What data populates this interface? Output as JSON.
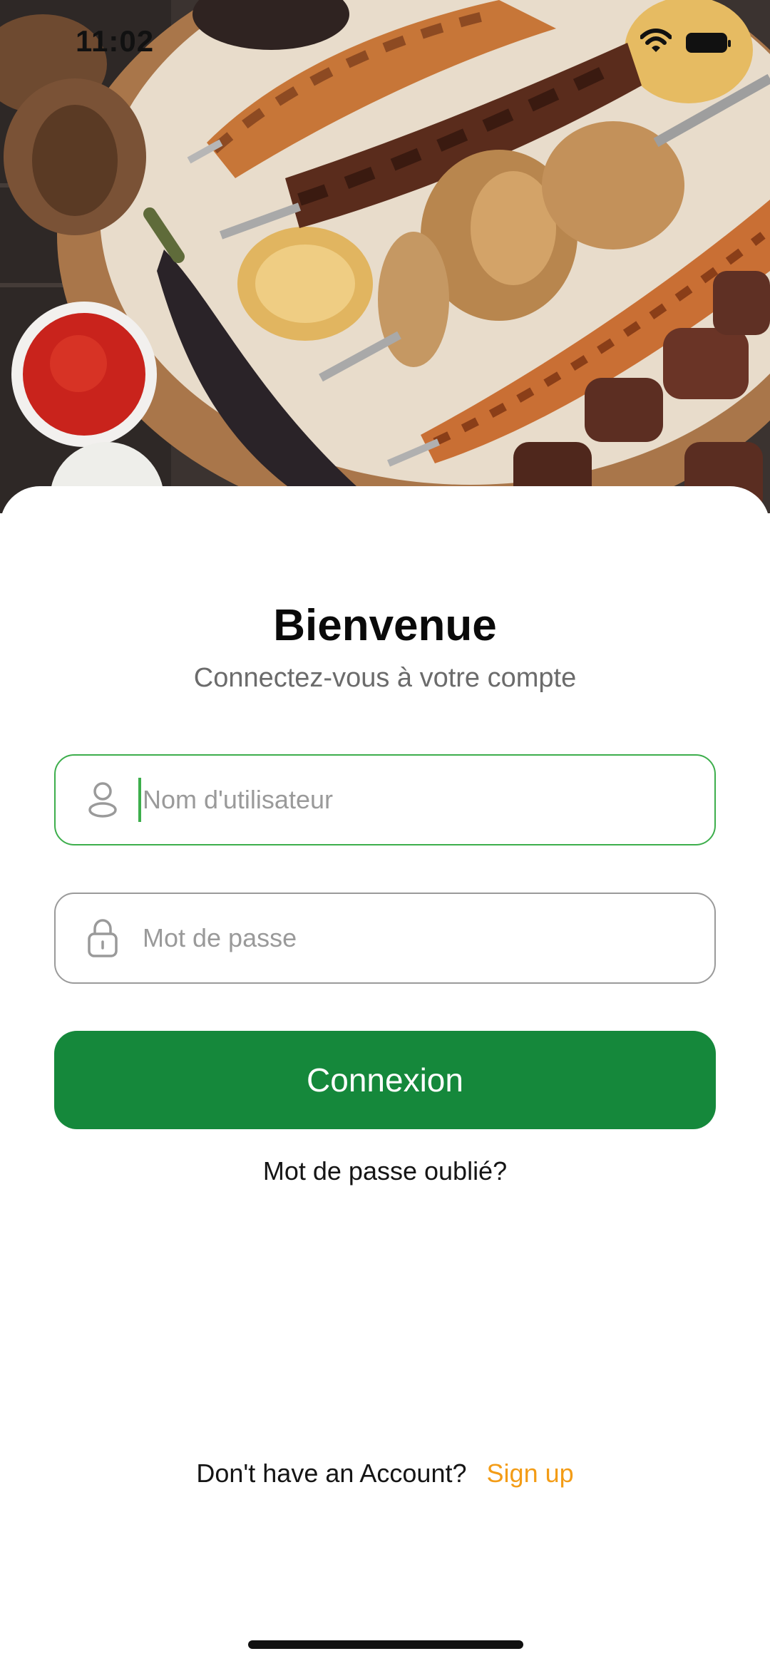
{
  "status_bar": {
    "time": "11:02",
    "wifi_icon": "wifi-icon",
    "battery_icon": "battery-icon"
  },
  "hero": {
    "image": "grilled-meat-platter-photo"
  },
  "login": {
    "title": "Bienvenue",
    "subtitle": "Connectez-vous à votre compte",
    "username": {
      "placeholder": "Nom d'utilisateur",
      "value": "",
      "icon": "user-icon"
    },
    "password": {
      "placeholder": "Mot de passe",
      "value": "",
      "icon": "lock-icon"
    },
    "submit_label": "Connexion",
    "forgot_label": "Mot de passe oublié?"
  },
  "signup": {
    "prompt": "Don't have an Account?",
    "link_label": "Sign up"
  },
  "colors": {
    "primary": "#15883b",
    "accent": "#f39c16",
    "focus": "#3dae4c"
  }
}
